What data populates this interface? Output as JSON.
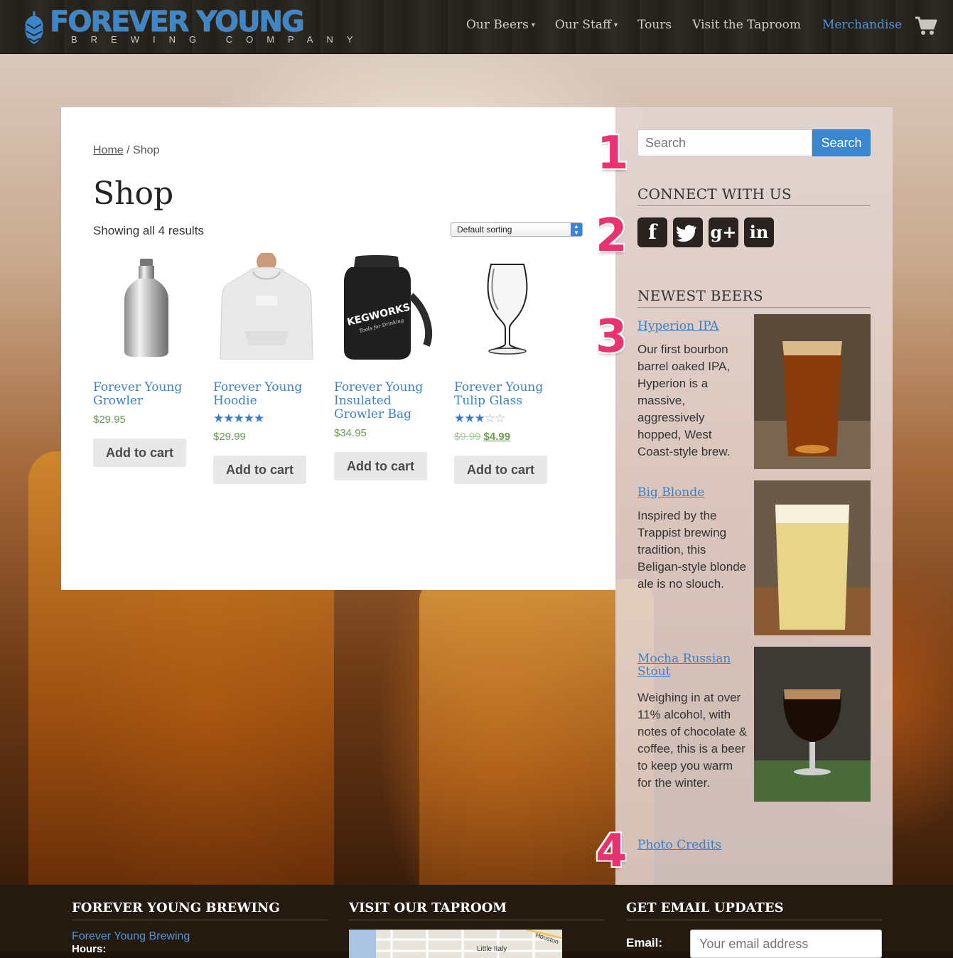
{
  "brand": {
    "title": "FOREVER YOUNG",
    "subtitle": "BREWING COMPANY"
  },
  "nav": {
    "items": [
      {
        "label": "Our Beers",
        "dropdown": true
      },
      {
        "label": "Our Staff",
        "dropdown": true
      },
      {
        "label": "Tours",
        "dropdown": false
      },
      {
        "label": "Visit the Taproom",
        "dropdown": false
      },
      {
        "label": "Merchandise",
        "dropdown": false,
        "active": true
      }
    ],
    "cart_icon": "cart-icon"
  },
  "breadcrumb": {
    "home": "Home",
    "separator": " / ",
    "current": "Shop"
  },
  "shop": {
    "title": "Shop",
    "result_count": "Showing all 4 results",
    "sort_selected": "Default sorting",
    "products": [
      {
        "name": "Forever Young Growler",
        "price": "$29.95",
        "rating": 0,
        "button": "Add to cart"
      },
      {
        "name": "Forever Young Hoodie",
        "price": "$29.99",
        "rating": 5,
        "button": "Add to cart"
      },
      {
        "name": "Forever Young Insulated Growler Bag",
        "price": "$34.95",
        "rating": 0,
        "button": "Add to cart"
      },
      {
        "name": "Forever Young Tulip Glass",
        "old_price": "$9.99",
        "price": "$4.99",
        "rating": 3,
        "button": "Add to cart"
      }
    ],
    "bag_brand": "KEGWORKS",
    "bag_tagline": "Tools for Drinking"
  },
  "sidebar": {
    "search_placeholder": "Search",
    "search_button": "Search",
    "connect_title": "CONNECT WITH US",
    "social": [
      "facebook-icon",
      "twitter-icon",
      "google-plus-icon",
      "linkedin-icon"
    ],
    "newest_title": "NEWEST BEERS",
    "beers": [
      {
        "name": "Hyperion IPA",
        "desc": "Our first bourbon barrel oaked IPA, Hyperion is a massive, aggressively hopped, West Coast-style brew."
      },
      {
        "name": "Big Blonde",
        "desc": "Inspired by the Trappist brewing tradition, this Beligan-style blonde ale is no slouch."
      },
      {
        "name": "Mocha Russian Stout",
        "desc": "Weighing in at over 11% alcohol, with notes of chocolate & coffee, this is a beer to keep you warm for the winter."
      }
    ],
    "photo_credits": "Photo Credits"
  },
  "callouts": [
    "1",
    "2",
    "3",
    "4"
  ],
  "footer": {
    "col1_title": "FOREVER YOUNG BREWING",
    "col1_link": "Forever Young Brewing",
    "col1_hours": "Hours:",
    "col2_title": "VISIT OUR TAPROOM",
    "map_label_1": "Little Italy",
    "map_label_2": "Houston",
    "col3_title": "GET EMAIL UPDATES",
    "email_label": "Email:",
    "email_placeholder": "Your email address"
  },
  "colors": {
    "accent": "#3c80c6",
    "price_green": "#6a9a55",
    "callout": "#e9336f",
    "footer_bg": "#251a10"
  }
}
